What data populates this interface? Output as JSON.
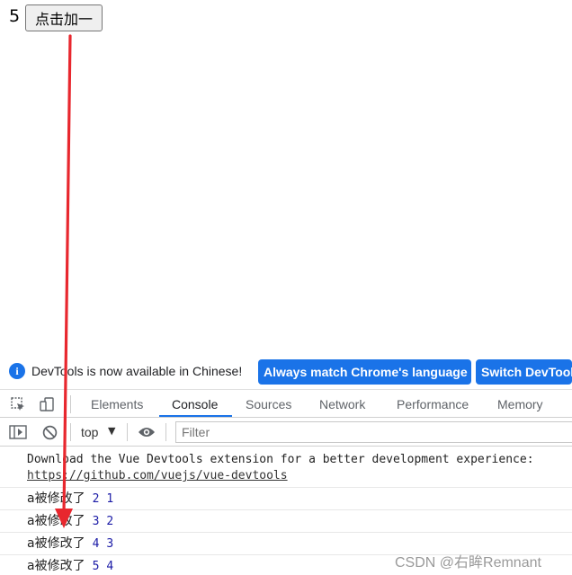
{
  "page": {
    "count": "5",
    "button_label": "点击加一"
  },
  "devtools": {
    "infobar": {
      "message": "DevTools is now available in Chinese!",
      "btn_match": "Always match Chrome's language",
      "btn_switch": "Switch DevTools to Chinese"
    },
    "tabs": [
      "Elements",
      "Console",
      "Sources",
      "Network",
      "Performance",
      "Memory"
    ],
    "active_tab": "Console",
    "console_toolbar": {
      "context": "top",
      "filter_placeholder": "Filter"
    },
    "messages": {
      "download_line": "Download the Vue Devtools extension for a better development experience:",
      "download_link": "https://github.com/vuejs/vue-devtools",
      "rows": [
        {
          "label": "a被修改了",
          "new": "2",
          "old": "1"
        },
        {
          "label": "a被修改了",
          "new": "3",
          "old": "2"
        },
        {
          "label": "a被修改了",
          "new": "4",
          "old": "3"
        },
        {
          "label": "a被修改了",
          "new": "5",
          "old": "4"
        }
      ]
    }
  },
  "watermark": "CSDN @右眸Remnant",
  "colors": {
    "accent_blue": "#1a73e8",
    "annotation_red": "#e8272e",
    "number_blue": "#1a1aa6"
  },
  "icons": {
    "inspect": "inspect-element-icon",
    "device": "device-toolbar-icon",
    "sidebar": "console-sidebar-icon",
    "clear": "clear-console-icon",
    "eye": "live-expression-icon",
    "info": "info-icon"
  }
}
